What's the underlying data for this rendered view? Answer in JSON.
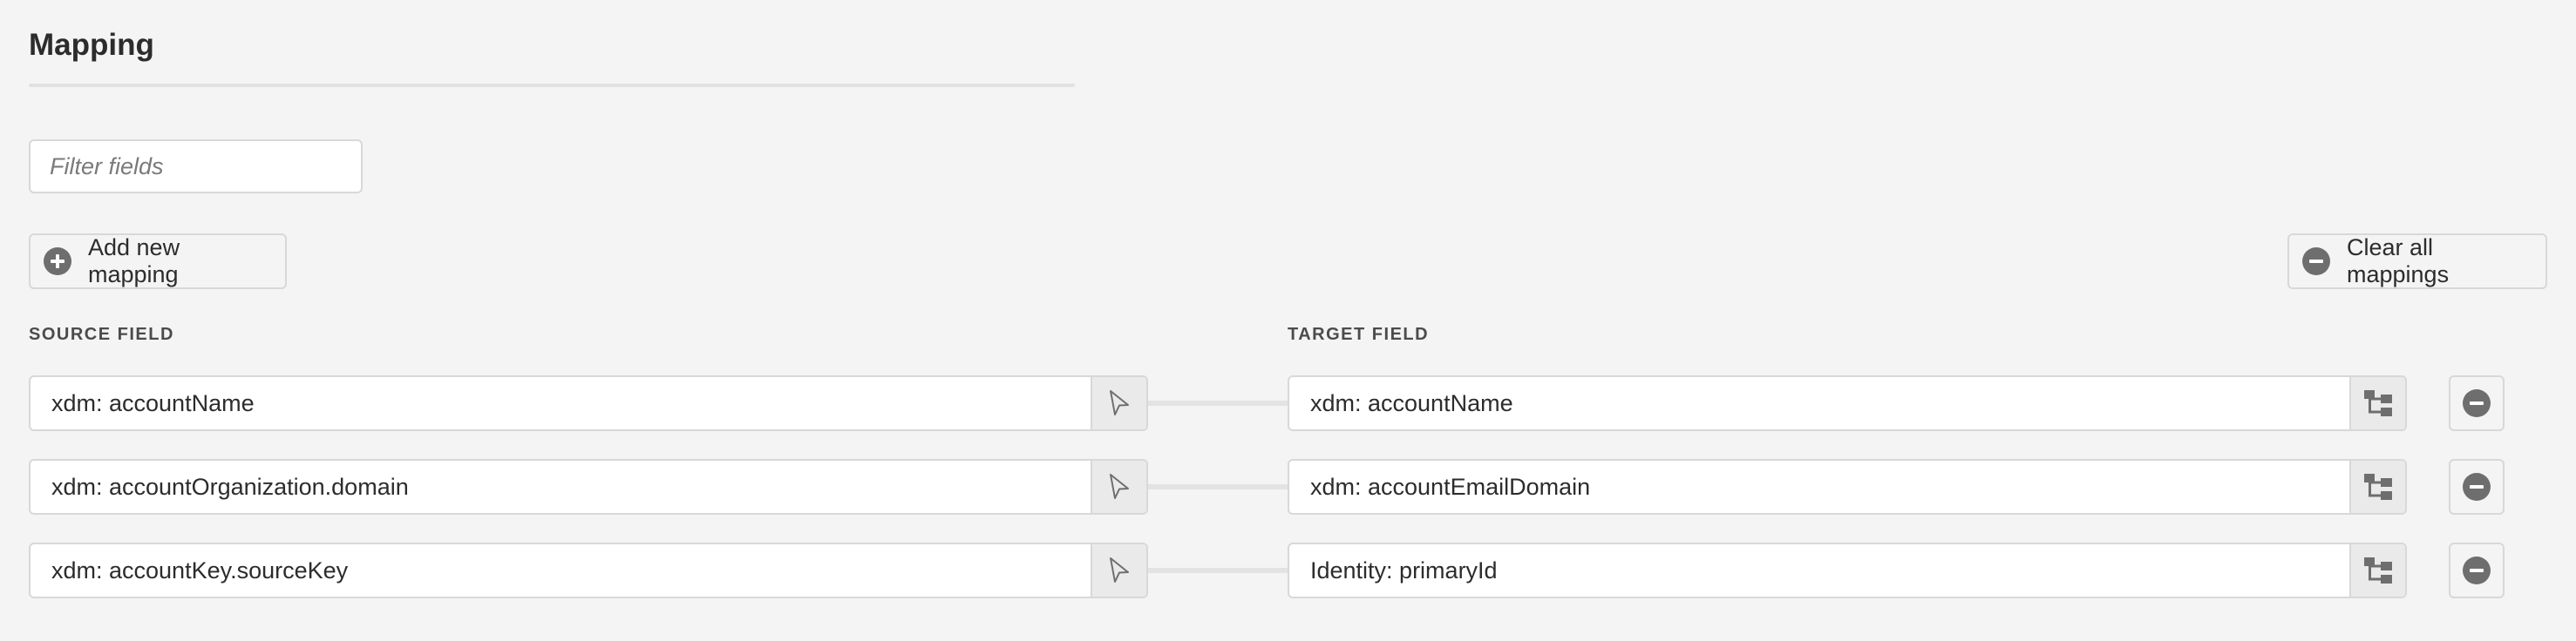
{
  "header": {
    "title": "Mapping"
  },
  "filter": {
    "placeholder": "Filter fields"
  },
  "actions": {
    "add_label": "Add new mapping",
    "clear_label": "Clear all mappings"
  },
  "columns": {
    "source": "SOURCE FIELD",
    "target": "TARGET FIELD"
  },
  "mappings": [
    {
      "source": "xdm: accountName",
      "target": "xdm: accountName"
    },
    {
      "source": "xdm: accountOrganization.domain",
      "target": "xdm: accountEmailDomain"
    },
    {
      "source": "xdm: accountKey.sourceKey",
      "target": "Identity: primaryId"
    }
  ],
  "icons": {
    "add": "add-circle-icon",
    "clear": "remove-circle-icon",
    "source_picker": "select-cursor-icon",
    "target_picker": "schema-tree-icon",
    "remove_row": "remove-circle-icon"
  },
  "colors": {
    "background": "#f4f4f4",
    "icon": "#6e6e6e"
  }
}
